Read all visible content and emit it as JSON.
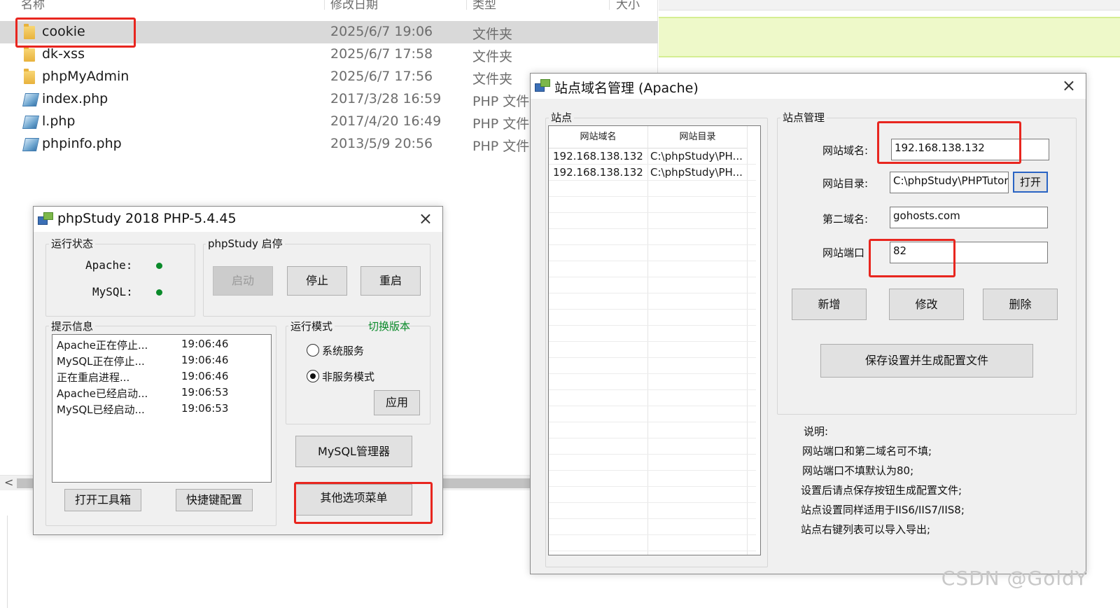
{
  "explorer": {
    "columns": {
      "name": "名称",
      "date": "修改日期",
      "type": "类型",
      "size": "大小"
    },
    "files": [
      {
        "name": "cookie",
        "date": "2025/6/7 19:06",
        "type": "文件夹",
        "icon": "folder-icon"
      },
      {
        "name": "dk-xss",
        "date": "2025/6/7 17:58",
        "type": "文件夹",
        "icon": "folder-icon"
      },
      {
        "name": "phpMyAdmin",
        "date": "2025/6/7 17:56",
        "type": "文件夹",
        "icon": "folder-icon"
      },
      {
        "name": "index.php",
        "date": "2017/3/28 16:59",
        "type": "PHP 文件",
        "icon": "php-file-icon"
      },
      {
        "name": "l.php",
        "date": "2017/4/20 16:49",
        "type": "PHP 文件",
        "icon": "php-file-icon"
      },
      {
        "name": "phpinfo.php",
        "date": "2013/5/9 20:56",
        "type": "PHP 文件",
        "icon": "php-file-icon"
      }
    ],
    "scroll_left": "<"
  },
  "phpstudy": {
    "title": "phpStudy 2018   PHP-5.4.45",
    "close": "×",
    "status_group": "运行状态",
    "apache_label": "Apache:",
    "mysql_label": "MySQL:",
    "status_color": "#0a8a2a",
    "control_group": "phpStudy  启停",
    "start": "启动",
    "stop": "停止",
    "restart": "重启",
    "log_group": "提示信息",
    "log": [
      {
        "msg": "Apache正在停止...",
        "time": "19:06:46"
      },
      {
        "msg": "MySQL正在停止...",
        "time": "19:06:46"
      },
      {
        "msg": "正在重启进程...",
        "time": "19:06:46"
      },
      {
        "msg": "Apache已经启动...",
        "time": "19:06:53"
      },
      {
        "msg": "MySQL已经启动...",
        "time": "19:06:53"
      }
    ],
    "mode_group": "运行模式",
    "switch_version": "切换版本",
    "mode_service": "系统服务",
    "mode_nonservice": "非服务模式",
    "apply": "应用",
    "mysql_manager": "MySQL管理器",
    "toolbox": "打开工具箱",
    "hotkeys": "快捷键配置",
    "other_menu": "其他选项菜单"
  },
  "sites": {
    "title": "站点域名管理 (Apache)",
    "close": "×",
    "list_group": "站点",
    "col_domain": "网站域名",
    "col_dir": "网站目录",
    "rows": [
      {
        "domain": "192.168.138.132",
        "dir": "C:\\phpStudy\\PH..."
      },
      {
        "domain": "192.168.138.132",
        "dir": "C:\\phpStudy\\PH..."
      }
    ],
    "manage_group": "站点管理",
    "domain_label": "网站域名:",
    "domain_value": "192.168.138.132",
    "dir_label": "网站目录:",
    "dir_value": "C:\\phpStudy\\PHPTutor",
    "open": "打开",
    "second_label": "第二域名:",
    "second_value": "gohosts.com",
    "port_label": "网站端口",
    "port_value": "82",
    "add": "新增",
    "modify": "修改",
    "delete": "删除",
    "save": "保存设置并生成配置文件",
    "notes": [
      "说明:",
      "网站端口和第二域名可不填;",
      "网站端口不填默认为80;",
      "设置后请点保存按钮生成配置文件;",
      "站点设置同样适用于IIS6/IIS7/IIS8;",
      "站点右键列表可以导入导出;"
    ]
  },
  "watermark": "CSDN @GoldY",
  "highlight_color": "#e8261f"
}
